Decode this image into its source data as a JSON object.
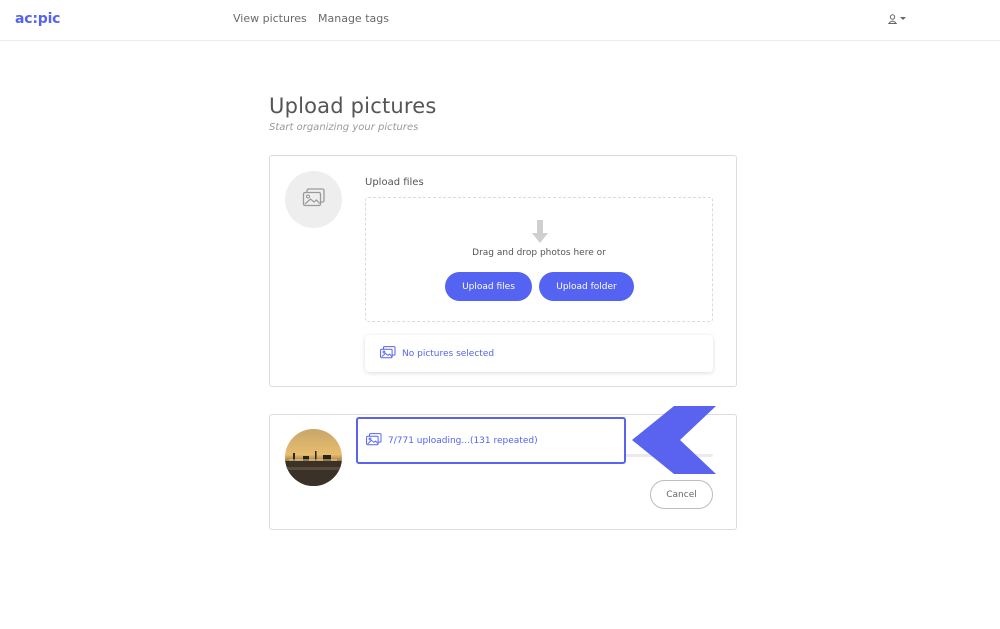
{
  "navbar": {
    "logo": "ac:pic",
    "links": [
      {
        "label": "View pictures"
      },
      {
        "label": "Manage tags"
      }
    ],
    "user_icon": "user-icon"
  },
  "header": {
    "title": "Upload pictures",
    "subtitle": "Start organizing your pictures"
  },
  "upload": {
    "label": "Upload files",
    "icon": "image-icon",
    "drop_icon": "arrow-down-icon",
    "drop_text": "Drag and drop photos here or",
    "upload_files_label": "Upload files",
    "upload_folder_label": "Upload folder",
    "selection_text": "No pictures selected"
  },
  "progress": {
    "status_text": "7/771 uploading...(131 repeated)",
    "uploaded": 7,
    "total": 771,
    "repeated": 131,
    "progress_fraction": 0.009,
    "cancel_label": "Cancel"
  },
  "colors": {
    "accent": "#5563f3",
    "pointer": "#5a62f0"
  }
}
